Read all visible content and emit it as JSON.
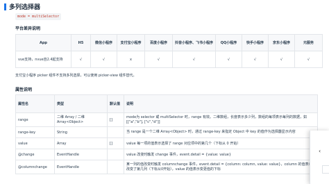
{
  "header": {
    "title": "多列选择器",
    "code": "mode = multiSelector"
  },
  "platform_section": {
    "title": "平台差异说明",
    "columns": [
      "App",
      "H5",
      "微信小程序",
      "支付宝小程序",
      "百度小程序",
      "抖音小程序、飞书小程序",
      "QQ小程序",
      "快手小程序",
      "京东小程序",
      "元服务"
    ],
    "row": [
      "vue支持，nvue自2.4起支持",
      "√",
      "√",
      "x",
      "√",
      "√",
      "√",
      "√",
      "√",
      "√"
    ]
  },
  "note": "支付宝小程序 picker 组件不支持多列选择，可以使用 picker-view 组件替代。",
  "attr_section": {
    "title": "属性说明",
    "headers": [
      "属性名",
      "类型",
      "默认值",
      "说明"
    ],
    "rows": [
      {
        "name": "range",
        "type": "二维 Array / 二维 Array<Object>",
        "default": "[]",
        "desc": "mode为 selector 或 multiSelector 时，range 有效。二维数组，长度表示多少列，数组的每项表示每列的数据，如[[\"a\",\"b\"], [\"c\",\"d\"]]"
      },
      {
        "name": "range-key",
        "type": "String",
        "default": "",
        "desc": "当 range 是一个二维 Array<Object> 时，通过 range-key 来指定 Object 中 key 的值作为选择器显示内容"
      },
      {
        "name": "value",
        "type": "Array",
        "default": "[]",
        "desc": "value 每一项的值表示选择了 range 对应项中的第几个（下标从 0 开始）"
      },
      {
        "name": "@change",
        "type": "EventHandle",
        "default": "",
        "desc": "value 改变时触发 change 事件，event.detail = {value: value}"
      },
      {
        "name": "@columnchange",
        "type": "EventHandle",
        "default": "",
        "desc": "某一列的值改变时触发 columnchange 事件，event.detail = {column: column, value: value}，column 的值表示改变了第几列（下标从0开始），value 的值表示变更值的下标"
      }
    ]
  },
  "colors": {
    "accent": "#1a73e8",
    "code": "#c0392b"
  }
}
